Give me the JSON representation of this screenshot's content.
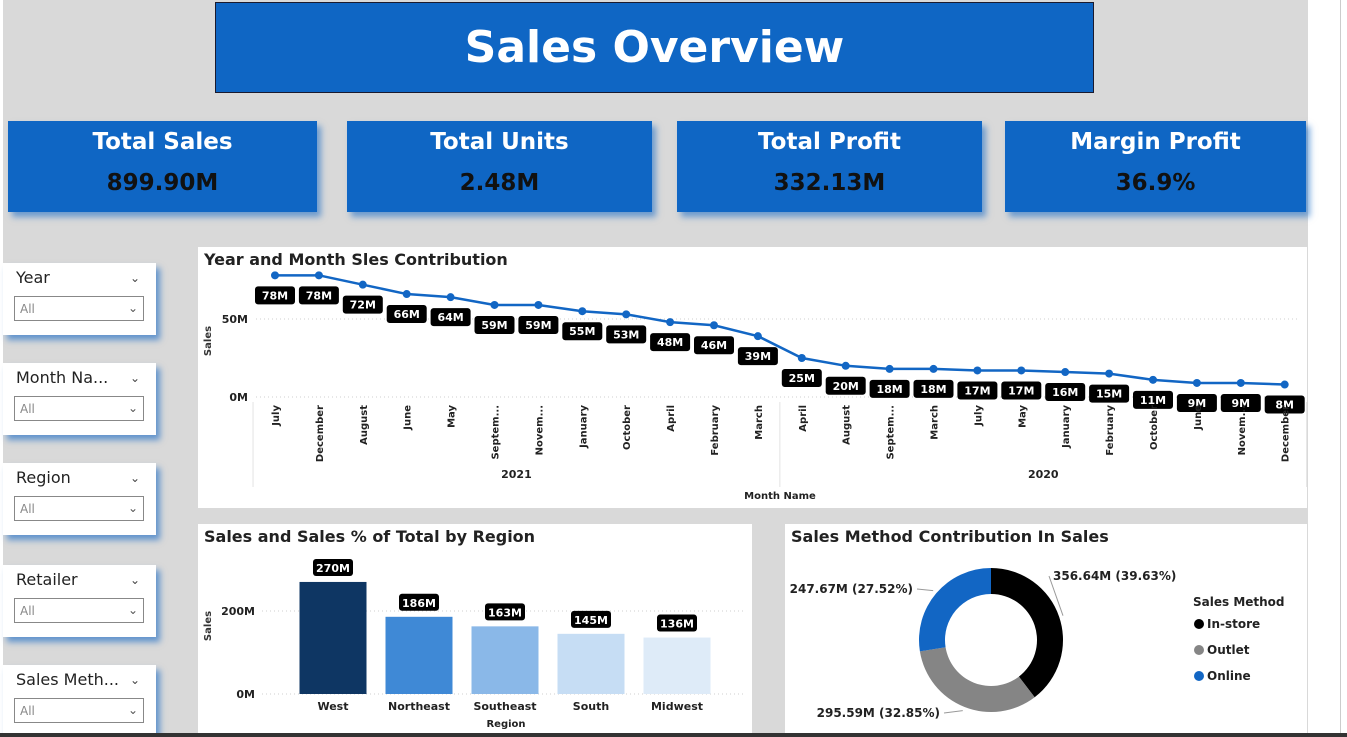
{
  "title": "Sales Overview",
  "kpis": [
    {
      "label": "Total Sales",
      "value": "899.90M"
    },
    {
      "label": "Total Units",
      "value": "2.48M"
    },
    {
      "label": "Total Profit",
      "value": "332.13M"
    },
    {
      "label": "Margin Profit",
      "value": "36.9%"
    }
  ],
  "slicers": [
    {
      "title": "Year",
      "value": "All"
    },
    {
      "title": "Month Na...",
      "value": "All"
    },
    {
      "title": "Region",
      "value": "All"
    },
    {
      "title": "Retailer",
      "value": "All"
    },
    {
      "title": "Sales Meth...",
      "value": "All"
    }
  ],
  "chart_data": [
    {
      "type": "line",
      "title": "Year and Month Sles Contribution",
      "xlabel": "Month Name",
      "ylabel": "Sales",
      "yticks": [
        "0M",
        "50M"
      ],
      "ylim": [
        0,
        80
      ],
      "groups": [
        {
          "name": "2021",
          "categories": [
            "July",
            "December",
            "August",
            "June",
            "May",
            "Septem...",
            "Novem...",
            "January",
            "October",
            "April",
            "February",
            "March"
          ],
          "values": [
            78,
            78,
            72,
            66,
            64,
            59,
            59,
            55,
            53,
            48,
            46,
            39
          ],
          "labels": [
            "78M",
            "78M",
            "72M",
            "66M",
            "64M",
            "59M",
            "59M",
            "55M",
            "53M",
            "48M",
            "46M",
            "39M"
          ]
        },
        {
          "name": "2020",
          "categories": [
            "April",
            "August",
            "Septem...",
            "March",
            "July",
            "May",
            "January",
            "February",
            "October",
            "June",
            "Novem...",
            "December"
          ],
          "values": [
            25,
            20,
            18,
            18,
            17,
            17,
            16,
            15,
            11,
            9,
            9,
            8
          ],
          "labels": [
            "25M",
            "20M",
            "18M",
            "18M",
            "17M",
            "17M",
            "16M",
            "15M",
            "11M",
            "9M",
            "9M",
            "8M"
          ]
        }
      ],
      "color": "#1266c4"
    },
    {
      "type": "bar",
      "title": "Sales and Sales % of Total by Region",
      "xlabel": "Region",
      "ylabel": "Sales",
      "yticks": [
        "0M",
        "200M"
      ],
      "ylim": [
        0,
        300
      ],
      "categories": [
        "West",
        "Northeast",
        "Southeast",
        "South",
        "Midwest"
      ],
      "values": [
        270,
        186,
        163,
        145,
        136
      ],
      "labels": [
        "270M",
        "186M",
        "163M",
        "145M",
        "136M"
      ],
      "colors": [
        "#0e3663",
        "#3f89d6",
        "#8ab8e8",
        "#c6ddf4",
        "#deebf8"
      ]
    },
    {
      "type": "pie",
      "title": "Sales Method Contribution In Sales",
      "legend_title": "Sales Method",
      "legend_position": "right",
      "slices": [
        {
          "name": "In-store",
          "value": 356.64,
          "label": "356.64M (39.63%)",
          "color": "#000000"
        },
        {
          "name": "Outlet",
          "value": 295.59,
          "label": "295.59M (32.85%)",
          "color": "#858585"
        },
        {
          "name": "Online",
          "value": 247.67,
          "label": "247.67M (27.52%)",
          "color": "#1266c4"
        }
      ]
    }
  ]
}
